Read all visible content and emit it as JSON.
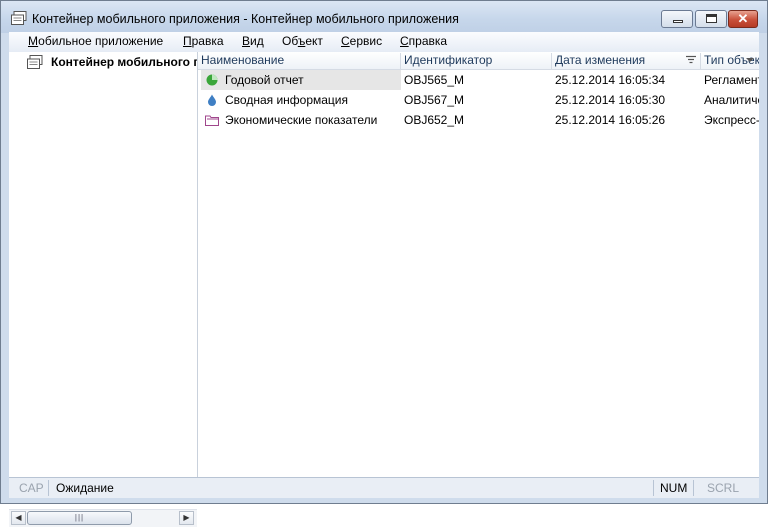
{
  "window": {
    "title": "Контейнер мобильного приложения - Контейнер мобильного приложения",
    "icon": "document-container-icon",
    "controls": {
      "minimize": "minimize",
      "maximize": "maximize",
      "close": "✕"
    }
  },
  "menu": {
    "items": [
      {
        "label": "Мобильное приложение",
        "hotkey": "М"
      },
      {
        "label": "Правка",
        "hotkey": "П"
      },
      {
        "label": "Вид",
        "hotkey": "В"
      },
      {
        "label": "Объект",
        "hotkey": "ъ"
      },
      {
        "label": "Сервис",
        "hotkey": "С"
      },
      {
        "label": "Справка",
        "hotkey": "С"
      }
    ]
  },
  "tree": {
    "root": {
      "label": "Контейнер мобильного приложения",
      "icon": "container-icon"
    }
  },
  "list": {
    "columns": [
      "Наименование",
      "Идентификатор",
      "Дата изменения",
      "Тип объекта"
    ],
    "rows": [
      {
        "name": "Годовой отчет",
        "id": "OBJ565_M",
        "date": "25.12.2014 16:05:34",
        "type": "Регламентный отчет",
        "icon": "pie-chart-icon",
        "color": "#3aa63a"
      },
      {
        "name": "Сводная информация",
        "id": "OBJ567_M",
        "date": "25.12.2014 16:05:30",
        "type": "Аналитическая панель",
        "icon": "drop-icon",
        "color": "#3f7fc4"
      },
      {
        "name": "Экономические показатели",
        "id": "OBJ652_M",
        "date": "25.12.2014 16:05:26",
        "type": "Экспресс-отчет",
        "icon": "folder-icon",
        "color": "#a0468c"
      }
    ]
  },
  "status": {
    "cap": "CAP",
    "message": "Ожидание",
    "num": "NUM",
    "scrl": "SCRL"
  }
}
